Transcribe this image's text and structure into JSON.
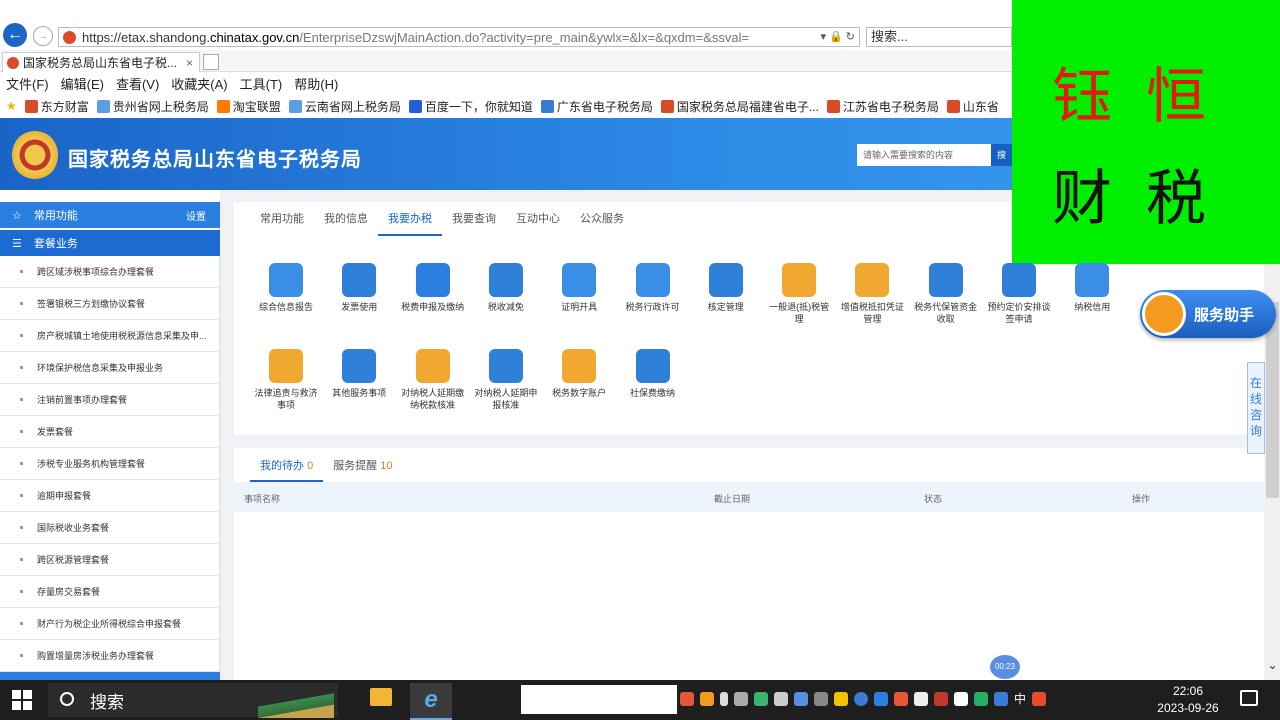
{
  "browser": {
    "url_host_prefix": "https://etax.shandong.",
    "url_host": "chinatax.gov.cn",
    "url_path": "/EnterpriseDzswjMainAction.do?activity=pre_main&ywlx=&lx=&qxdm=&ssval=",
    "search_placeholder": "搜索...",
    "tab_title": "国家税务总局山东省电子税...",
    "tab_close": "×",
    "menu": [
      "文件(F)",
      "编辑(E)",
      "查看(V)",
      "收藏夹(A)",
      "工具(T)",
      "帮助(H)"
    ],
    "favorites": [
      "东方财富",
      "贵州省网上税务局",
      "淘宝联盟",
      "云南省网上税务局",
      "百度一下，你就知道",
      "广东省电子税务局",
      "国家税务总局福建省电子...",
      "江苏省电子税务局",
      "山东省"
    ]
  },
  "site": {
    "title": "国家税务总局山东省电子税务局",
    "search_placeholder": "请输入需要搜索的内容",
    "search_button": "搜"
  },
  "overlay": {
    "line1": "钰恒",
    "line2": "财税"
  },
  "sidebar": {
    "common_label": "常用功能",
    "settings_label": "设置",
    "package_label": "套餐业务",
    "items": [
      "跨区域涉税事项综合办理套餐",
      "签署银税三方划缴协议套餐",
      "房产税城镇土地使用税税源信息采集及申...",
      "环境保护税信息采集及申报业务",
      "注销前置事项办理套餐",
      "发票套餐",
      "涉税专业服务机构管理套餐",
      "逾期申报套餐",
      "国际税收业务套餐",
      "跨区税源管理套餐",
      "存量房交易套餐",
      "财产行为税企业所得税综合申报套餐",
      "购置增量房涉税业务办理套餐"
    ]
  },
  "main_tabs": [
    "常用功能",
    "我的信息",
    "我要办税",
    "我要查询",
    "互动中心",
    "公众服务"
  ],
  "active_tab": "我要办税",
  "services_row1": [
    {
      "label": "综合信息报告",
      "icon": "document-icon",
      "color": "#3a8ee6"
    },
    {
      "label": "发票使用",
      "icon": "invoice-icon",
      "color": "#2f80d8"
    },
    {
      "label": "税费申报及缴纳",
      "icon": "layers-icon",
      "color": "#2b7de0"
    },
    {
      "label": "税收减免",
      "icon": "yuan-icon",
      "color": "#2f80d8"
    },
    {
      "label": "证明开具",
      "icon": "pen-icon",
      "color": "#3a8ee6"
    },
    {
      "label": "税务行政许可",
      "icon": "approval-icon",
      "color": "#3a8ee6"
    },
    {
      "label": "核定管理",
      "icon": "folder-icon",
      "color": "#2f80d8"
    },
    {
      "label": "一般退(抵)税管理",
      "icon": "refund-hand-icon",
      "color": "#f0a830"
    },
    {
      "label": "增值税抵扣凭证管理",
      "icon": "list-icon",
      "color": "#f0a830"
    },
    {
      "label": "税务代保管资金收取",
      "icon": "money-doc-icon",
      "color": "#2f80d8"
    },
    {
      "label": "预约定价安排谈签申请",
      "icon": "chart-icon",
      "color": "#2f80d8"
    },
    {
      "label": "纳税信用",
      "icon": "thumbs-up-icon",
      "color": "#3a8ee6"
    }
  ],
  "services_row2": [
    {
      "label": "法律追责与救济事项",
      "icon": "gavel-icon",
      "color": "#f0a830"
    },
    {
      "label": "其他服务事项",
      "icon": "grid-icon",
      "color": "#2f80d8"
    },
    {
      "label": "对纳税人延期缴纳税款核准",
      "icon": "extend-hand-icon",
      "color": "#f0a830"
    },
    {
      "label": "对纳税人延期申报核准",
      "icon": "wallet-icon",
      "color": "#2f80d8"
    },
    {
      "label": "税务数字账户",
      "icon": "account-new-icon",
      "color": "#f0a830"
    },
    {
      "label": "社保费缴纳",
      "icon": "social-hands-icon",
      "color": "#2f80d8"
    }
  ],
  "todo": {
    "tab1_label": "我的待办",
    "tab1_count": "0",
    "tab2_label": "服务提醒",
    "tab2_count": "10",
    "headers": [
      "事项名称",
      "截止日期",
      "状态",
      "操作"
    ]
  },
  "float": {
    "helper_label": "服务助手",
    "online_label": "在线咨询",
    "timer": "00:23"
  },
  "taskbar": {
    "search_label": "搜索",
    "ime_label": "中",
    "time": "22:06",
    "date": "2023-09-26"
  }
}
